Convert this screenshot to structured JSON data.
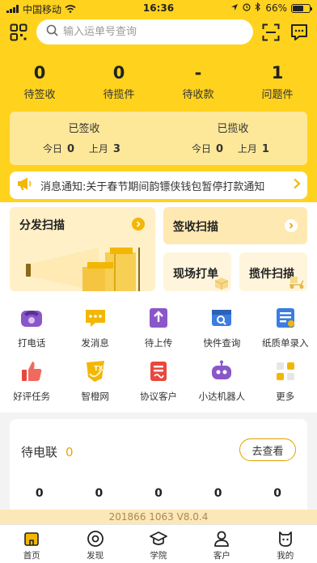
{
  "status_bar": {
    "carrier": "中国移动",
    "time": "16:36",
    "battery": "66%"
  },
  "search": {
    "placeholder": "输入运单号查询"
  },
  "stats": [
    {
      "value": "0",
      "label": "待签收"
    },
    {
      "value": "0",
      "label": "待揽件"
    },
    {
      "value": "-",
      "label": "待收款"
    },
    {
      "value": "1",
      "label": "问题件"
    }
  ],
  "summary": {
    "signed": {
      "title": "已签收",
      "today_label": "今日",
      "today_value": "0",
      "month_label": "上月",
      "month_value": "3"
    },
    "collected": {
      "title": "已揽收",
      "today_label": "今日",
      "today_value": "0",
      "month_label": "上月",
      "month_value": "1"
    }
  },
  "notice": {
    "text": "消息通知:关于春节期间韵镖侠钱包暂停打款通知"
  },
  "tiles": {
    "dispatch_scan": "分发扫描",
    "sign_scan": "签收扫描",
    "onsite_print": "现场打单",
    "collect_scan": "揽件扫描"
  },
  "quick_actions_row1": [
    {
      "label": "打电话",
      "icon": "phone-icon"
    },
    {
      "label": "发消息",
      "icon": "message-icon"
    },
    {
      "label": "待上传",
      "icon": "upload-icon"
    },
    {
      "label": "快件查询",
      "icon": "package-search-icon"
    },
    {
      "label": "纸质单录入",
      "icon": "paper-form-icon"
    }
  ],
  "quick_actions_row2": [
    {
      "label": "好评任务",
      "icon": "thumbs-up-icon"
    },
    {
      "label": "智橙网",
      "icon": "tx-badge-icon"
    },
    {
      "label": "协议客户",
      "icon": "contract-icon"
    },
    {
      "label": "小达机器人",
      "icon": "robot-icon"
    },
    {
      "label": "更多",
      "icon": "more-grid-icon"
    }
  ],
  "pending_call": {
    "title": "待电联",
    "count": "0",
    "button": "去查看",
    "sub_values": [
      "0",
      "0",
      "0",
      "0",
      "0"
    ]
  },
  "version": "201866  1063  V8.0.4",
  "tabbar": [
    {
      "label": "首页",
      "icon": "home-icon"
    },
    {
      "label": "发现",
      "icon": "discover-icon"
    },
    {
      "label": "学院",
      "icon": "academy-icon"
    },
    {
      "label": "客户",
      "icon": "customer-icon"
    },
    {
      "label": "我的",
      "icon": "profile-icon"
    }
  ],
  "colors": {
    "brand_yellow": "#ffd21e",
    "accent": "#e8a700"
  }
}
